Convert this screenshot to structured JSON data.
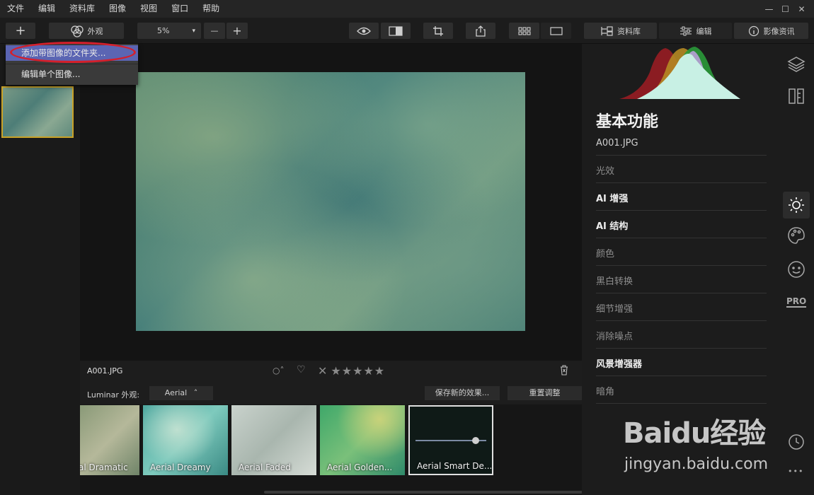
{
  "menubar": {
    "items": [
      "文件",
      "编辑",
      "资料库",
      "图像",
      "视图",
      "窗口",
      "帮助"
    ],
    "window_controls": [
      "—",
      "☐",
      "✕"
    ]
  },
  "toolbar": {
    "add_label": "+",
    "looks_label": "外观",
    "zoom_value": "5%",
    "zoom_minus": "—",
    "zoom_plus": "+",
    "library_label": "资料库",
    "edit_label": "编辑",
    "info_label": "影像资讯"
  },
  "dropdown": {
    "items": [
      "添加带图像的文件夹...",
      "编辑单个图像..."
    ]
  },
  "infobar": {
    "filename": "A001.JPG",
    "circle_icon": "○˄",
    "heart_icon": "♡",
    "reject_icon": "✕",
    "stars": "★★★★★",
    "stars_rating": 0
  },
  "looksbar": {
    "label": "Luminar 外观:",
    "category": "Aerial",
    "category_caret": "˄",
    "save_label": "保存新的效果...",
    "reset_label": "重置调整"
  },
  "looks": [
    {
      "label": "al Dramatic"
    },
    {
      "label": "Aerial Dreamy"
    },
    {
      "label": "Aerial Faded"
    },
    {
      "label": "Aerial Golden..."
    },
    {
      "label": "Aerial Smart De...",
      "selected": true,
      "slider": 0.85
    }
  ],
  "panel": {
    "title": "基本功能",
    "filename": "A001.JPG",
    "tools": [
      {
        "label": "光效",
        "bold": false
      },
      {
        "label": "AI 增强",
        "bold": true
      },
      {
        "label": "AI 结构",
        "bold": true
      },
      {
        "label": "颜色",
        "bold": false
      },
      {
        "label": "黑白转换",
        "bold": false
      },
      {
        "label": "细节增强",
        "bold": false
      },
      {
        "label": "消除噪点",
        "bold": false
      },
      {
        "label": "风景增强器",
        "bold": true
      },
      {
        "label": "暗角",
        "bold": false
      }
    ]
  },
  "rail": {
    "pro_label": "PRO",
    "more_label": "•••"
  },
  "watermark": {
    "brand": "Baidu经验",
    "url": "jingyan.baidu.com"
  },
  "colors": {
    "accent_highlight": "#5b65b3",
    "annotation_red": "#d41f2b",
    "selected_border": "#c9a227"
  }
}
